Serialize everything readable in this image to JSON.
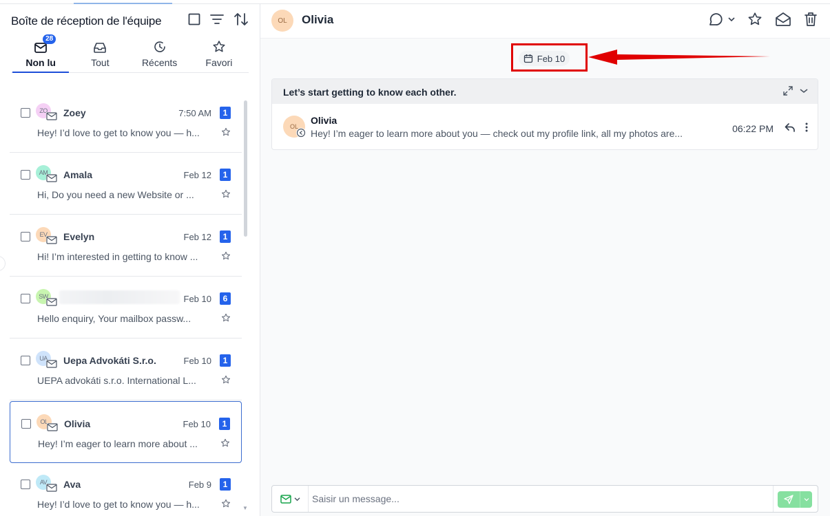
{
  "inbox": {
    "title": "Boîte de réception de l'équipe",
    "tabs": [
      {
        "label": "Non lu",
        "badge": "28",
        "active": true,
        "icon": "mail-icon"
      },
      {
        "label": "Tout",
        "icon": "inbox-icon"
      },
      {
        "label": "Récents",
        "icon": "clock-icon"
      },
      {
        "label": "Favori",
        "icon": "star-icon"
      }
    ],
    "conversations": [
      {
        "initials": "ZO",
        "name": "Zoey",
        "date": "7:50 AM",
        "count": "1",
        "preview": "Hey! I’d love to get to know you — h...",
        "avatar_color": "#f5d0f5"
      },
      {
        "initials": "AM",
        "name": "Amala",
        "date": "Feb 12",
        "count": "1",
        "preview": "Hi,   Do you need a new Website or ...",
        "avatar_color": "#a7f0d8"
      },
      {
        "initials": "EV",
        "name": "Evelyn",
        "date": "Feb 12",
        "count": "1",
        "preview": "Hi! I’m interested in getting to know ...",
        "avatar_color": "#fcd9b8"
      },
      {
        "initials": "SW",
        "name": "",
        "date": "Feb 10",
        "count": "6",
        "preview": "Hello  enquiry, Your mailbox passw...",
        "avatar_color": "#c8f5b0",
        "name_blurred": true
      },
      {
        "initials": "UA",
        "name": "Uepa Advokáti S.r.o.",
        "date": "Feb 10",
        "count": "1",
        "preview": "UEPA advokáti s.r.o. International L...",
        "avatar_color": "#cfe3fb"
      },
      {
        "initials": "OL",
        "name": "Olivia",
        "date": "Feb 10",
        "count": "1",
        "preview": "Hey! I’m eager to learn more about ...",
        "avatar_color": "#fcd9b8",
        "selected": true
      },
      {
        "initials": "AV",
        "name": "Ava",
        "date": "Feb 9",
        "count": "1",
        "preview": "Hey! I’d love to get to know you — h...",
        "avatar_color": "#bfe9f7"
      }
    ]
  },
  "conversation": {
    "contact_initials": "OL",
    "contact_name": "Olivia",
    "date_chip": "Feb 10",
    "thread": {
      "subject": "Let’s start getting to know each other.",
      "message": {
        "initials": "OL",
        "from": "Olivia",
        "time": "06:22 PM",
        "preview": "Hey! I’m eager to learn more about you — check out my profile link, all my photos are..."
      }
    },
    "composer": {
      "placeholder": "Saisir un message..."
    }
  },
  "colors": {
    "accent": "#2563eb",
    "highlight": "#e00000",
    "send": "#86e0a0"
  }
}
